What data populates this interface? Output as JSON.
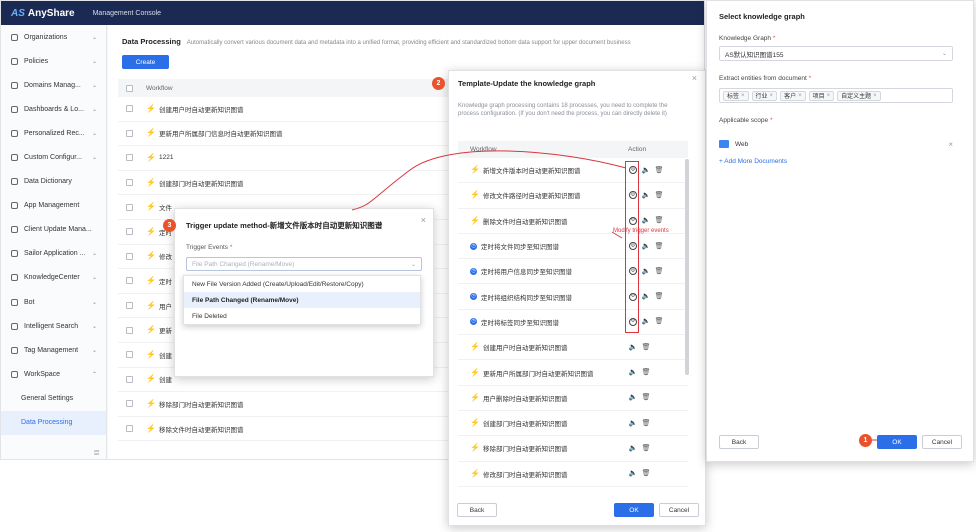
{
  "app": {
    "logo_mark": "AS",
    "logo_text": "AnyShare",
    "console_title": "Management Console"
  },
  "sidebar": {
    "items": [
      {
        "label": "Organizations",
        "icon": "org-icon",
        "chevron": "⌄"
      },
      {
        "label": "Policies",
        "icon": "policy-icon",
        "chevron": "⌄"
      },
      {
        "label": "Domains Manag...",
        "icon": "domain-icon",
        "chevron": "⌄"
      },
      {
        "label": "Dashboards & Lo...",
        "icon": "dashboard-icon",
        "chevron": "⌄"
      },
      {
        "label": "Personalized Rec...",
        "icon": "recommend-icon",
        "chevron": "⌄"
      },
      {
        "label": "Custom Configur...",
        "icon": "config-icon",
        "chevron": "⌄"
      },
      {
        "label": "Data Dictionary",
        "icon": "dictionary-icon",
        "chevron": ""
      },
      {
        "label": "App Management",
        "icon": "app-icon",
        "chevron": ""
      },
      {
        "label": "Client Update Mana...",
        "icon": "client-icon",
        "chevron": ""
      },
      {
        "label": "Sailor Application ...",
        "icon": "sailor-icon",
        "chevron": "⌄"
      },
      {
        "label": "KnowledgeCenter",
        "icon": "knowledge-icon",
        "chevron": "⌄"
      },
      {
        "label": "Bot",
        "icon": "bot-icon",
        "chevron": "⌄"
      },
      {
        "label": "Intelligent Search",
        "icon": "search-icon",
        "chevron": "⌄"
      },
      {
        "label": "Tag Management",
        "icon": "tag-icon",
        "chevron": "⌄"
      },
      {
        "label": "WorkSpace",
        "icon": "workspace-icon",
        "chevron": "⌃"
      }
    ],
    "sub_items": [
      {
        "label": "General Settings"
      },
      {
        "label": "Data Processing"
      }
    ],
    "footer_icon": "≣"
  },
  "main": {
    "title": "Data Processing",
    "description": "Automatically convert various document data and metadata into a unified format, providing efficient and standardized bottom data support for upper document business",
    "create_label": "Create",
    "column_workflow": "Workflow",
    "rows": [
      {
        "icon": "bolt",
        "name": "创建用户时自动更新知识图谱"
      },
      {
        "icon": "bolt",
        "name": "更新用户所属部门信息时自动更新知识图谱"
      },
      {
        "icon": "bolt",
        "name": "1221"
      },
      {
        "icon": "bolt",
        "name": "创建部门时自动更新知识图谱"
      },
      {
        "icon": "bolt",
        "name": "文件"
      },
      {
        "icon": "bolt",
        "name": "定时"
      },
      {
        "icon": "bolt",
        "name": "修改"
      },
      {
        "icon": "bolt",
        "name": "定时"
      },
      {
        "icon": "bolt",
        "name": "用户"
      },
      {
        "icon": "bolt",
        "name": "更新"
      },
      {
        "icon": "bolt",
        "name": "创建"
      },
      {
        "icon": "bolt",
        "name": "创建"
      },
      {
        "icon": "bolt",
        "name": "移除部门时自动更新知识图谱"
      },
      {
        "icon": "bolt",
        "name": "移除文件时自动更新知识图谱"
      }
    ]
  },
  "template_dialog": {
    "badge": "2",
    "title": "Template-Update the knowledge graph",
    "description": "Knowledge graph processing contains 18 processes, you need to complete the process configuration. (If you don't need the process, you can directly delete it)",
    "column_workflow": "Workflow",
    "column_action": "Action",
    "rows": [
      {
        "icon": "bolt",
        "name": "新增文件版本时自动更新知识图谱",
        "editable": true
      },
      {
        "icon": "bolt",
        "name": "修改文件路径时自动更新知识图谱",
        "editable": true
      },
      {
        "icon": "bolt",
        "name": "删除文件时自动更新知识图谱",
        "editable": true
      },
      {
        "icon": "clock",
        "name": "定时将文件同步至知识图谱",
        "editable": true
      },
      {
        "icon": "clock",
        "name": "定时将用户信息同步至知识图谱",
        "editable": true
      },
      {
        "icon": "clock",
        "name": "定时将组织结构同步至知识图谱",
        "editable": true
      },
      {
        "icon": "clock",
        "name": "定时将标签同步至知识图谱",
        "editable": true
      },
      {
        "icon": "bolt",
        "name": "创建用户时自动更新知识图谱",
        "editable": false
      },
      {
        "icon": "bolt",
        "name": "更新用户所属部门时自动更新知识图谱",
        "editable": false
      },
      {
        "icon": "bolt",
        "name": "用户删除时自动更新知识图谱",
        "editable": false
      },
      {
        "icon": "bolt",
        "name": "创建部门时自动更新知识图谱",
        "editable": false
      },
      {
        "icon": "bolt",
        "name": "移除部门时自动更新知识图谱",
        "editable": false
      },
      {
        "icon": "bolt",
        "name": "修改部门时自动更新知识图谱",
        "editable": false
      }
    ],
    "back_label": "Back",
    "ok_label": "OK",
    "cancel_label": "Cancel",
    "annotation": "Modify trigger events"
  },
  "trigger_dialog": {
    "badge": "3",
    "title": "Trigger update method-新增文件版本时自动更新知识图谱",
    "field_label": "Trigger Events",
    "required_mark": "*",
    "select_value": "File Path Changed (Rename/Move)",
    "chevron": "⌄",
    "options": [
      {
        "label": "New File Version Added (Create/Upload/Edit/Restore/Copy)",
        "selected": false
      },
      {
        "label": "File Path Changed (Rename/Move)",
        "selected": true
      },
      {
        "label": "File Deleted",
        "selected": false
      }
    ]
  },
  "kg_panel": {
    "title": "Select knowledge graph",
    "graph_label": "Knowledge Graph",
    "graph_value": "AS默认知识图谱155",
    "entities_label": "Extract entities from document",
    "entities": [
      "标签",
      "行业",
      "客户",
      "项目",
      "自定义主题"
    ],
    "scope_label": "Applicable scope",
    "scope_item": "Web",
    "add_more_label": "+ Add More Documents",
    "required_mark": "*",
    "back_label": "Back",
    "ok_label": "OK",
    "cancel_label": "Cancel",
    "badge": "1"
  },
  "icons": {
    "close": "×",
    "bolt": "⚡",
    "clock": "◷",
    "edit": "⚙",
    "speaker": "🔈",
    "trash": "🗑",
    "folder": "folder-icon"
  },
  "colors": {
    "primary": "#2a6ee8",
    "topbar": "#1a2a52",
    "annotation": "#d9363e",
    "badge": "#e8532b"
  }
}
